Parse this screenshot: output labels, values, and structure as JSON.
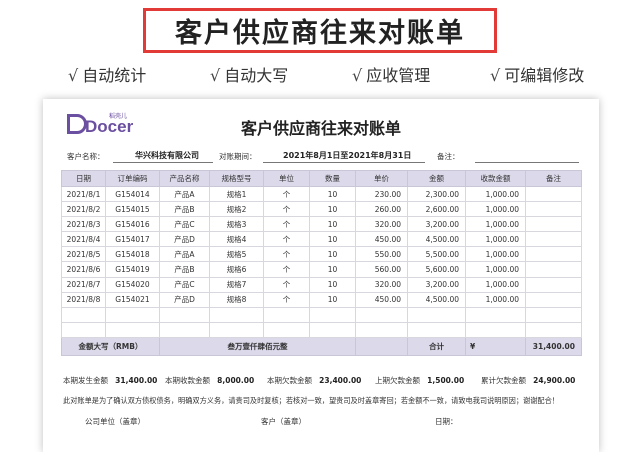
{
  "banner": {
    "title": "客户供应商往来对账单"
  },
  "features": [
    {
      "check": "√",
      "label": "自动统计"
    },
    {
      "check": "√",
      "label": "自动大写"
    },
    {
      "check": "√",
      "label": "应收管理"
    },
    {
      "check": "√",
      "label": "可编辑修改"
    }
  ],
  "logo": {
    "text": "Docer",
    "small": "稻壳儿"
  },
  "document": {
    "title": "客户供应商往来对账单",
    "customer_label": "客户名称：",
    "customer_value": "华兴科技有限公司",
    "period_label": "对账期间：",
    "period_value": "2021年8月1日至2021年8月31日",
    "remark_label": "备注："
  },
  "table": {
    "headers": [
      "日期",
      "订单编码",
      "产品名称",
      "规格型号",
      "单位",
      "数量",
      "单价",
      "金额",
      "收款金额",
      "备注"
    ],
    "rows": [
      [
        "2021/8/1",
        "G154014",
        "产品A",
        "规格1",
        "个",
        "10",
        "230.00",
        "2,300.00",
        "1,000.00",
        ""
      ],
      [
        "2021/8/2",
        "G154015",
        "产品B",
        "规格2",
        "个",
        "10",
        "260.00",
        "2,600.00",
        "1,000.00",
        ""
      ],
      [
        "2021/8/3",
        "G154016",
        "产品C",
        "规格3",
        "个",
        "10",
        "320.00",
        "3,200.00",
        "1,000.00",
        ""
      ],
      [
        "2021/8/4",
        "G154017",
        "产品D",
        "规格4",
        "个",
        "10",
        "450.00",
        "4,500.00",
        "1,000.00",
        ""
      ],
      [
        "2021/8/5",
        "G154018",
        "产品A",
        "规格5",
        "个",
        "10",
        "550.00",
        "5,500.00",
        "1,000.00",
        ""
      ],
      [
        "2021/8/6",
        "G154019",
        "产品B",
        "规格6",
        "个",
        "10",
        "560.00",
        "5,600.00",
        "1,000.00",
        ""
      ],
      [
        "2021/8/7",
        "G154020",
        "产品C",
        "规格7",
        "个",
        "10",
        "320.00",
        "3,200.00",
        "1,000.00",
        ""
      ],
      [
        "2021/8/8",
        "G154021",
        "产品D",
        "规格8",
        "个",
        "10",
        "450.00",
        "4,500.00",
        "1,000.00",
        ""
      ],
      [
        "",
        "",
        "",
        "",
        "",
        "",
        "",
        "",
        "",
        ""
      ],
      [
        "",
        "",
        "",
        "",
        "",
        "",
        "",
        "",
        "",
        ""
      ]
    ],
    "total": {
      "upper_label": "金额大写（RMB）",
      "upper_value": "叁万壹仟肆佰元整",
      "sum_label": "合计",
      "currency": "¥",
      "sum_value": "31,400.00"
    }
  },
  "summary": {
    "items": [
      {
        "label": "本期发生金额",
        "value": "31,400.00"
      },
      {
        "label": "本期收款金额",
        "value": "8,000.00"
      },
      {
        "label": "本期欠款金额",
        "value": "23,400.00"
      },
      {
        "label": "上期欠款金额",
        "value": "1,500.00"
      },
      {
        "label": "累计欠款金额",
        "value": "24,900.00"
      }
    ]
  },
  "notice": "此对账单是为了确认双方债权债务，明确双方义务，请贵司及时复核；若核对一致，望贵司及时盖章寄回；若金额不一致，请致电我司说明原因；谢谢配合！",
  "signatures": {
    "company": "公司单位（盖章）",
    "customer": "客户（盖章）",
    "date": "日期："
  }
}
